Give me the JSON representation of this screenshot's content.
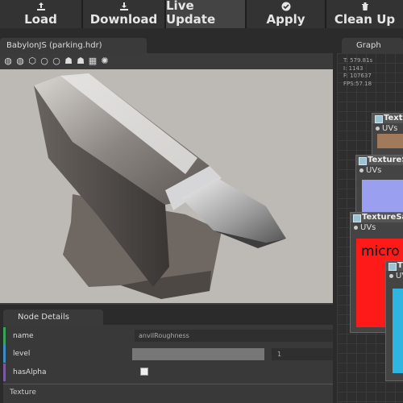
{
  "toolbar": {
    "buttons": [
      {
        "label": "Load",
        "icon": "upload-icon"
      },
      {
        "label": "Download",
        "icon": "download-icon"
      },
      {
        "label": "Live Update",
        "icon": "refresh-icon",
        "active": true
      },
      {
        "label": "Apply",
        "icon": "check-circle-icon"
      },
      {
        "label": "Clean Up",
        "icon": "trash-icon"
      }
    ]
  },
  "viewer": {
    "tab_label": "BabylonJS (parking.hdr)",
    "icons": [
      "globe-icon",
      "globe-icon",
      "cube-icon",
      "circle-icon",
      "circle-icon",
      "user-icon",
      "user-icon",
      "grid-icon",
      "spinner-icon"
    ]
  },
  "node_details": {
    "tab_label": "Node Details",
    "rows": [
      {
        "name": "name",
        "value": "anvilRoughness",
        "color": "#3aa35a"
      },
      {
        "name": "level",
        "value": "1",
        "color": "#3a8fc8"
      },
      {
        "name": "hasAlpha",
        "value": "",
        "color": "#7a5aa0"
      }
    ],
    "section": "Texture"
  },
  "graph": {
    "tab_label": "Graph",
    "stats": [
      "T: 579.81s",
      "I: 1143",
      "F: 107637",
      "FPS:57.18"
    ],
    "nodes": [
      {
        "title": "Texture",
        "port": "UVs",
        "preview_color": "#a07a5a"
      },
      {
        "title": "TextureS",
        "port": "UVs",
        "preview_color": "#9b9ff0"
      },
      {
        "title": "TextureSa",
        "port": "UVs",
        "preview_color": "#ff1a1a",
        "preview_text": "micro"
      },
      {
        "title": "T",
        "port": "UV",
        "preview_color": "#2fb6e0"
      }
    ]
  }
}
